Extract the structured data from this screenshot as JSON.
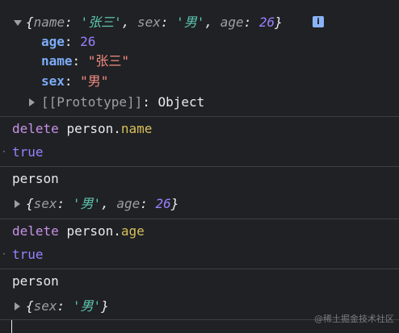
{
  "object_preview_1": {
    "open_brace": "{",
    "entries": [
      {
        "key": "name",
        "value": "'张三'"
      },
      {
        "key": "sex",
        "value": "'男'"
      },
      {
        "key": "age",
        "value": "26"
      }
    ],
    "close_brace": "}"
  },
  "expanded_props": [
    {
      "key": "age",
      "value": "26"
    },
    {
      "key": "name",
      "value": "\"张三\""
    },
    {
      "key": "sex",
      "value": "\"男\""
    }
  ],
  "prototype": {
    "label": "[[Prototype]]",
    "value": "Object"
  },
  "info_icon_label": "i",
  "cmd_delete_name": {
    "keyword": "delete",
    "object": "person",
    "dot": ".",
    "property": "name"
  },
  "result_1": "true",
  "cmd_person_1": "person",
  "object_preview_2": {
    "entries": [
      {
        "key": "sex",
        "value": "'男'"
      },
      {
        "key": "age",
        "value": "26"
      }
    ]
  },
  "cmd_delete_age": {
    "keyword": "delete",
    "object": "person",
    "dot": ".",
    "property": "age"
  },
  "result_2": "true",
  "cmd_person_2": "person",
  "object_preview_3": {
    "entries": [
      {
        "key": "sex",
        "value": "'男'"
      }
    ]
  },
  "watermark": "@稀土掘金技术社区"
}
